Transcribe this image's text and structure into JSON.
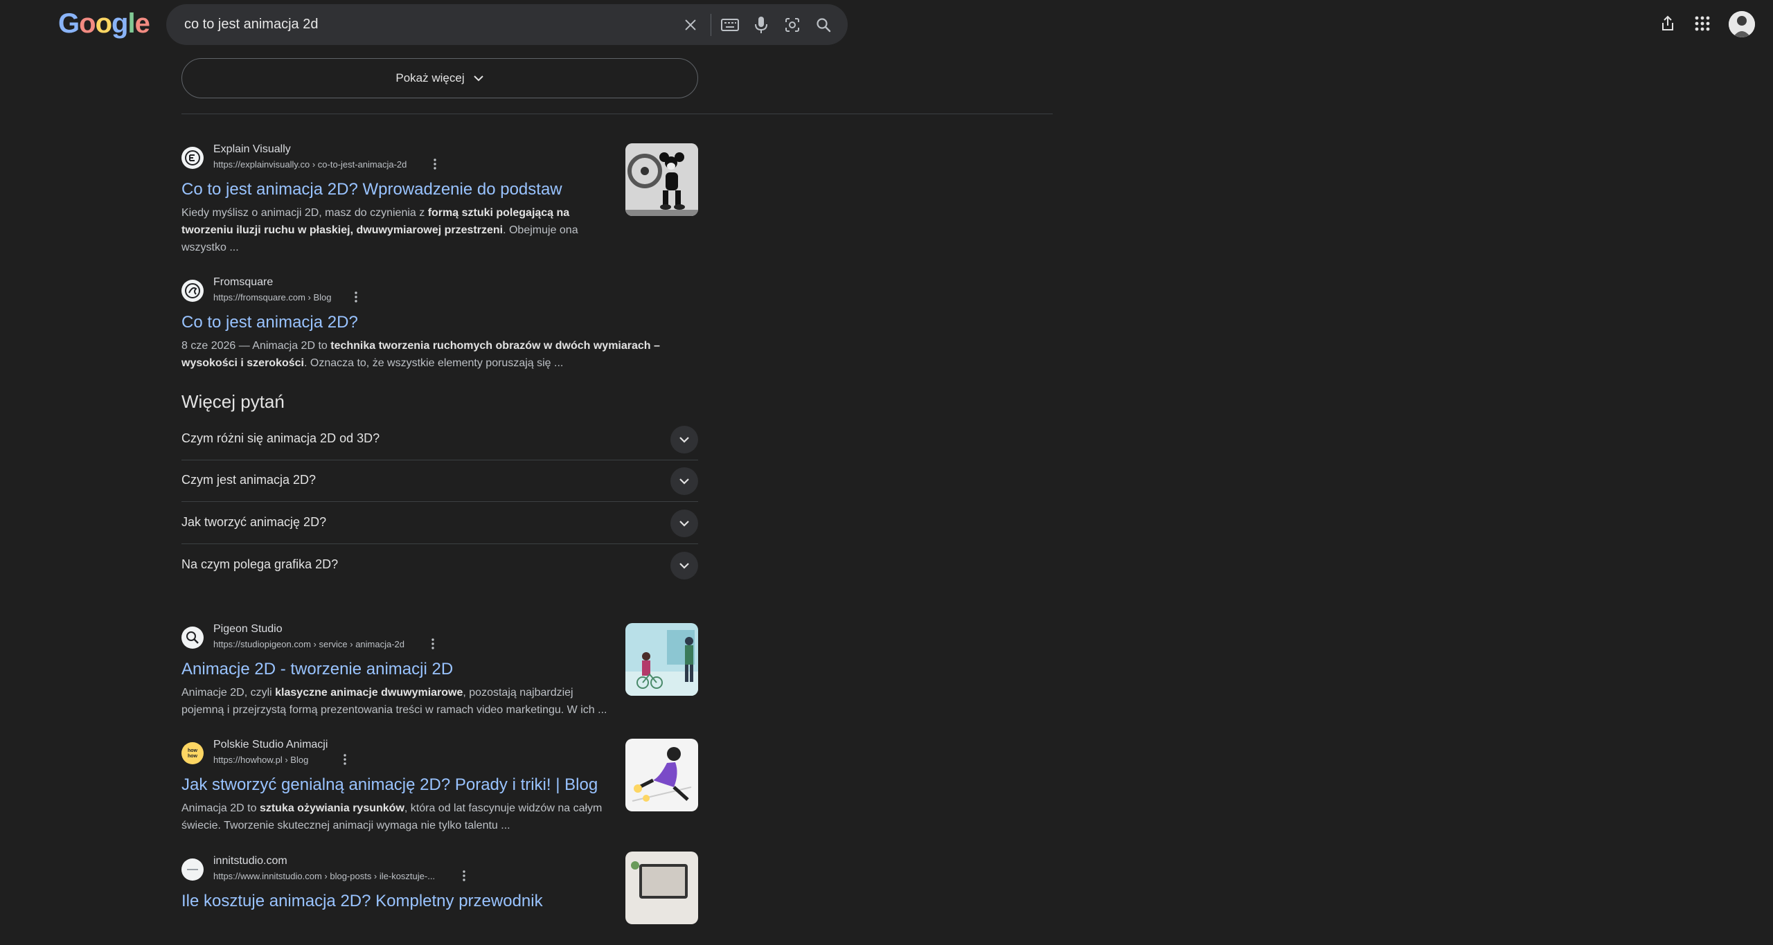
{
  "header": {
    "logo_letters": [
      "G",
      "o",
      "o",
      "g",
      "l",
      "e"
    ],
    "search_query": "co to jest animacja 2d",
    "icons": [
      "close-icon",
      "keyboard-icon",
      "microphone-icon",
      "lens-icon",
      "search-icon",
      "share-icon",
      "apps-icon",
      "avatar"
    ]
  },
  "show_more": {
    "label": "Pokaż więcej"
  },
  "results_top": [
    {
      "site_name": "Explain Visually",
      "url": "https://explainvisually.co › co-to-jest-animacja-2d",
      "title": "Co to jest animacja 2D? Wprowadzenie do podstaw",
      "snippet_parts": [
        {
          "t": "Kiedy myślisz o animacji 2D, masz do czynienia z ",
          "b": false
        },
        {
          "t": "formą sztuki polegającą na tworzeniu iluzji ruchu w płaskiej, dwuwymiarowej przestrzeni",
          "b": true
        },
        {
          "t": ". Obejmuje ona wszystko ...",
          "b": false
        }
      ]
    },
    {
      "site_name": "Fromsquare",
      "url": "https://fromsquare.com › Blog",
      "title": "Co to jest animacja 2D?",
      "snippet_parts": [
        {
          "t": "8 cze 2026 — Animacja 2D to ",
          "b": false
        },
        {
          "t": "technika tworzenia ruchomych obrazów w dwóch wymiarach – wysokości i szerokości",
          "b": true
        },
        {
          "t": ". Oznacza to, że wszystkie elementy poruszają się ...",
          "b": false
        }
      ]
    }
  ],
  "more_questions": {
    "title": "Więcej pytań",
    "items": [
      "Czym różni się animacja 2D od 3D?",
      "Czym jest animacja 2D?",
      "Jak tworzyć animację 2D?",
      "Na czym polega grafika 2D?"
    ]
  },
  "results_bottom": [
    {
      "site_name": "Pigeon Studio",
      "url": "https://studiopigeon.com › service › animacja-2d",
      "title": "Animacje 2D - tworzenie animacji 2D",
      "snippet_parts": [
        {
          "t": "Animacje 2D, czyli ",
          "b": false
        },
        {
          "t": "klasyczne animacje dwuwymiarowe",
          "b": true
        },
        {
          "t": ", pozostają najbardziej pojemną i przejrzystą formą prezentowania treści w ramach video marketingu. W ich ...",
          "b": false
        }
      ]
    },
    {
      "site_name": "Polskie Studio Animacji",
      "url": "https://howhow.pl › Blog",
      "title": "Jak stworzyć genialną animację 2D? Porady i triki! | Blog",
      "snippet_parts": [
        {
          "t": "Animacja 2D to ",
          "b": false
        },
        {
          "t": "sztuka ożywiania rysunków",
          "b": true
        },
        {
          "t": ", która od lat fascynuje widzów na całym świecie. Tworzenie skutecznej animacji wymaga nie tylko talentu ...",
          "b": false
        }
      ]
    },
    {
      "site_name": "innitstudio.com",
      "url": "https://www.innitstudio.com › blog-posts › ile-kosztuje-...",
      "title": "Ile kosztuje animacja 2D? Kompletny przewodnik",
      "snippet_parts": []
    }
  ],
  "colors": {
    "background": "#1f1f1f",
    "link": "#99c3ff",
    "searchbox": "#303134"
  }
}
